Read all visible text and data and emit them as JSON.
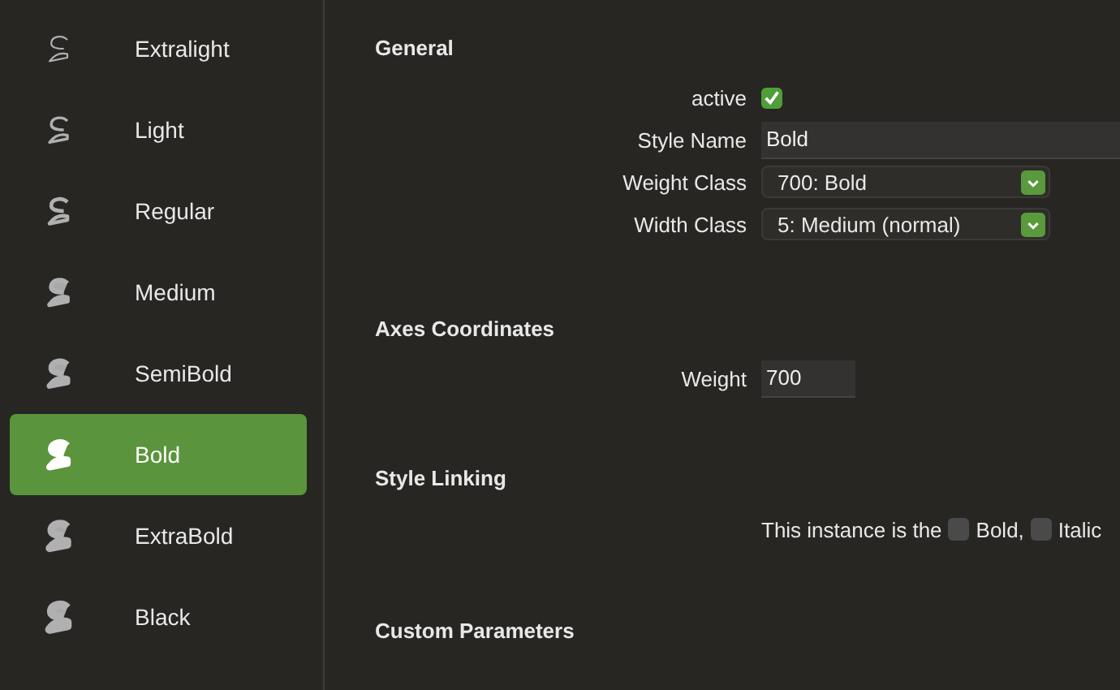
{
  "sidebar": {
    "items": [
      {
        "label": "Extralight",
        "selected": false
      },
      {
        "label": "Light",
        "selected": false
      },
      {
        "label": "Regular",
        "selected": false
      },
      {
        "label": "Medium",
        "selected": false
      },
      {
        "label": "SemiBold",
        "selected": false
      },
      {
        "label": "Bold",
        "selected": true
      },
      {
        "label": "ExtraBold",
        "selected": false
      },
      {
        "label": "Black",
        "selected": false
      }
    ]
  },
  "general": {
    "heading": "General",
    "active": {
      "label": "active",
      "checked": true
    },
    "style_name": {
      "label": "Style Name",
      "value": "Bold"
    },
    "weight_class": {
      "label": "Weight Class",
      "value": "700: Bold"
    },
    "width_class": {
      "label": "Width Class",
      "value": "5: Medium (normal)"
    }
  },
  "axes": {
    "heading": "Axes Coordinates",
    "weight": {
      "label": "Weight",
      "value": "700"
    }
  },
  "style_linking": {
    "heading": "Style Linking",
    "text": "This instance is the",
    "options": [
      {
        "label": "Bold,",
        "checked": false
      },
      {
        "label": "Italic",
        "checked": false
      }
    ]
  },
  "custom_parameters": {
    "heading": "Custom Parameters"
  }
}
